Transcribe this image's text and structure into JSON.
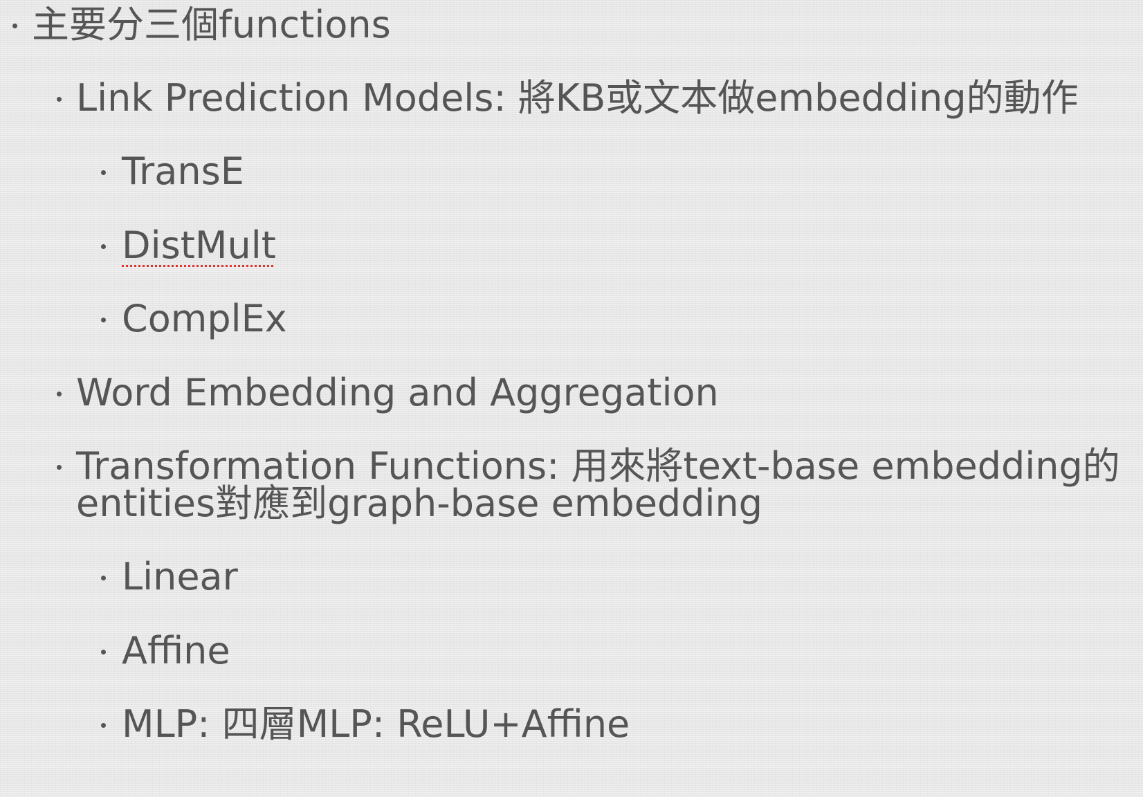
{
  "bullets": {
    "b0": "主要分三個functions",
    "b1": "Link Prediction Models: 將KB或文本做embedding的動作",
    "b1a": "TransE",
    "b1b": "DistMult",
    "b1c": "ComplEx",
    "b2": "Word Embedding and Aggregation",
    "b3_line1": "Transformation Functions: 用來將text-base embedding的",
    "b3_line2": "entities對應到graph-base embedding",
    "b3a": "Linear",
    "b3b": "Affine",
    "b3c": "MLP: 四層MLP: ReLU+Affine"
  },
  "colors": {
    "text": "#555555",
    "background": "#ebebeb",
    "spellcheck_underline": "#e0312c"
  }
}
